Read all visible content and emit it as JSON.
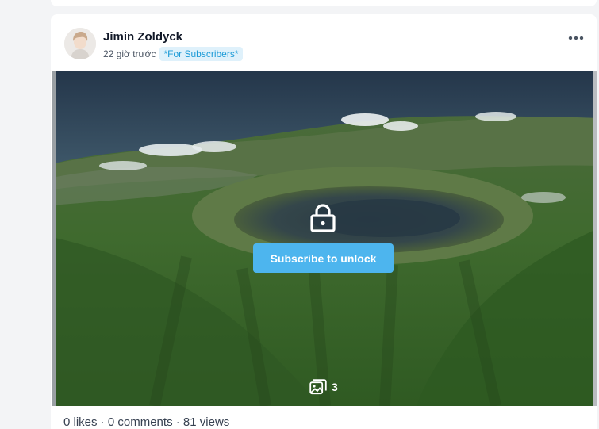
{
  "post": {
    "author": "Jimin Zoldyck",
    "time": "22 giờ trước",
    "badge": "*For Subscribers*",
    "unlock_label": "Subscribe to unlock",
    "image_count": "3",
    "stats": {
      "likes": "0 likes",
      "separator": " · ",
      "comments": "0 comments",
      "views": "81 views"
    }
  },
  "icons": {
    "more": "more-horizontal-icon",
    "lock": "lock-icon",
    "images": "images-icon"
  },
  "colors": {
    "accent": "#4db5ee",
    "badge_bg": "#dff1fb",
    "badge_text": "#1d9bd7"
  }
}
